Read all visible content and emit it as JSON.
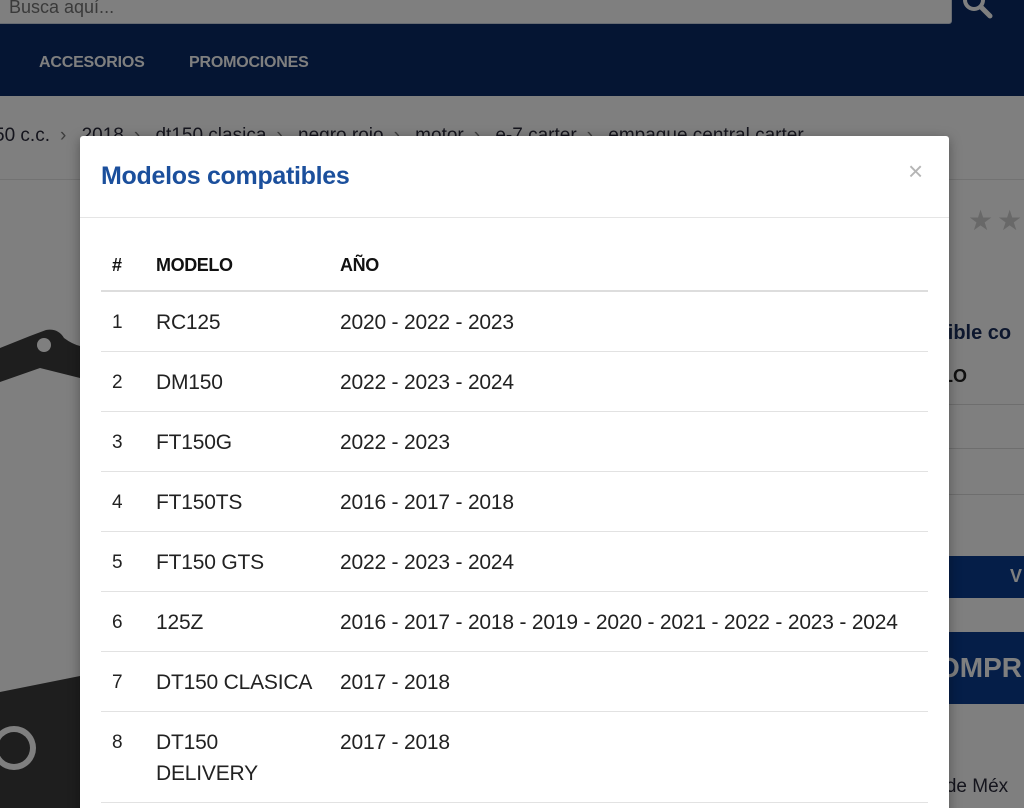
{
  "search": {
    "placeholder": "Busca aquí..."
  },
  "nav": [
    {
      "label": "ACCESORIOS"
    },
    {
      "label": "PROMOCIONES"
    }
  ],
  "breadcrumb": [
    "50 c.c.",
    "2018",
    "dt150 clasica",
    "negro rojo",
    "motor",
    "e-7 carter",
    "empaque central carter"
  ],
  "background": {
    "compat_title": "atible co",
    "modelo_header": "ELO",
    "blue_button": "V",
    "buy_button": "OMPR",
    "location": "d de Méx"
  },
  "modal": {
    "title": "Modelos compatibles",
    "close": "×",
    "columns": {
      "num": "#",
      "model": "MODELO",
      "year": "AÑO"
    },
    "rows": [
      {
        "num": "1",
        "model": "RC125",
        "years": "2020 - 2022 - 2023"
      },
      {
        "num": "2",
        "model": "DM150",
        "years": "2022 - 2023 - 2024"
      },
      {
        "num": "3",
        "model": "FT150G",
        "years": "2022 - 2023"
      },
      {
        "num": "4",
        "model": "FT150TS",
        "years": "2016 - 2017 - 2018"
      },
      {
        "num": "5",
        "model": "FT150 GTS",
        "years": "2022 - 2023 - 2024"
      },
      {
        "num": "6",
        "model": "125Z",
        "years": "2016 - 2017 - 2018 - 2019 - 2020 - 2021 - 2022 - 2023 - 2024"
      },
      {
        "num": "7",
        "model": "DT150 CLASICA",
        "years": "2017 - 2018"
      },
      {
        "num": "8",
        "model": "DT150 DELIVERY",
        "years": "2017 - 2018"
      }
    ]
  },
  "colors": {
    "header_bg": "#0a2a66",
    "modal_title": "#1b4f9c",
    "button_blue": "#0a3d91"
  },
  "icons": {
    "search": "search-icon",
    "close": "close-icon",
    "star": "star-icon"
  }
}
